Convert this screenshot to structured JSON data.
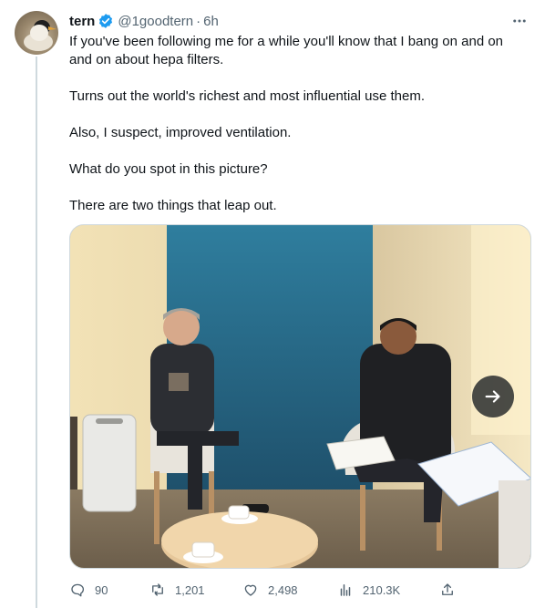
{
  "tweet": {
    "author_name": "tern",
    "handle": "@1goodtern",
    "separator": "·",
    "time": "6h",
    "verified": true,
    "paragraphs": [
      "If you've been following me for a while you'll know that I bang on and on and on about hepa filters.",
      "Turns out the world's richest and most influential use them.",
      "Also, I suspect, improved ventilation.",
      "What do you spot in this picture?",
      "There are two things that leap out."
    ]
  },
  "actions": {
    "replies": "90",
    "retweets": "1,201",
    "likes": "2,498",
    "views": "210.3K"
  },
  "colors": {
    "text_primary": "#0f1419",
    "text_secondary": "#536471",
    "verified_blue": "#1d9bf0",
    "border": "#cfd9de"
  },
  "icons": [
    "verified-badge-icon",
    "more-icon",
    "next-arrow-icon",
    "reply-icon",
    "retweet-icon",
    "like-icon",
    "views-icon",
    "share-icon"
  ]
}
